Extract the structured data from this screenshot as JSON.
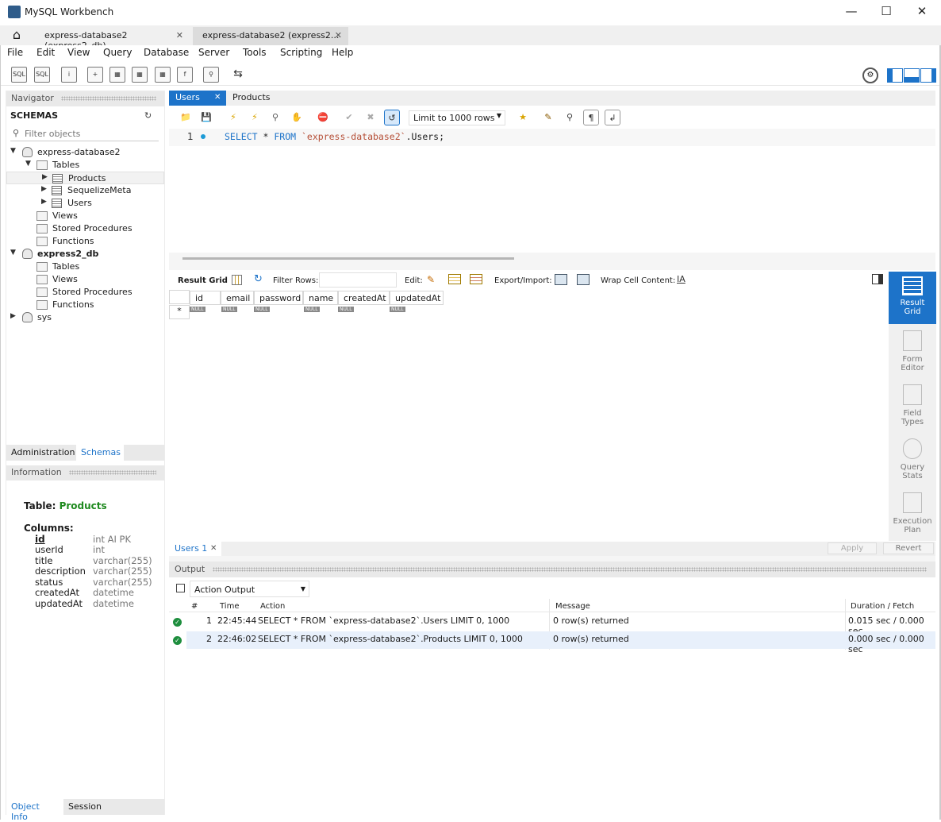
{
  "window": {
    "title": "MySQL Workbench",
    "min": "—",
    "max": "☐",
    "close": "✕"
  },
  "conn_tabs": [
    {
      "label": "express-database2 (express2_db)",
      "close": "✕"
    },
    {
      "label": "express-database2 (express2...",
      "close": "✕"
    }
  ],
  "menu": [
    "File",
    "Edit",
    "View",
    "Query",
    "Database",
    "Server",
    "Tools",
    "Scripting",
    "Help"
  ],
  "navigator": {
    "title": "Navigator",
    "schemas_label": "SCHEMAS",
    "filter_placeholder": "Filter objects",
    "tree": {
      "db1": "express-database2",
      "tables": "Tables",
      "t1": "Products",
      "t2": "SequelizeMeta",
      "t3": "Users",
      "views": "Views",
      "sp": "Stored Procedures",
      "fn": "Functions",
      "db2": "express2_db",
      "tables2": "Tables",
      "views2": "Views",
      "sp2": "Stored Procedures",
      "fn2": "Functions",
      "db3": "sys"
    },
    "tab_admin": "Administration",
    "tab_schemas": "Schemas"
  },
  "info": {
    "title": "Information",
    "table_prefix": "Table:",
    "table_name": "Products",
    "columns_label": "Columns:",
    "columns": [
      {
        "name": "id",
        "type": "int AI PK"
      },
      {
        "name": "userId",
        "type": "int"
      },
      {
        "name": "title",
        "type": "varchar(255)"
      },
      {
        "name": "description",
        "type": "varchar(255)"
      },
      {
        "name": "status",
        "type": "varchar(255)"
      },
      {
        "name": "createdAt",
        "type": "datetime"
      },
      {
        "name": "updatedAt",
        "type": "datetime"
      }
    ],
    "tab_objinfo": "Object Info",
    "tab_session": "Session"
  },
  "query_tabs": [
    {
      "label": "Users",
      "close": "✕"
    },
    {
      "label": "Products"
    }
  ],
  "limit": "Limit to 1000 rows",
  "editor": {
    "line_no": "1",
    "kw1": "SELECT",
    "star": "*",
    "kw2": "FROM",
    "ident": "`express-database2`",
    "rest": ".Users;"
  },
  "result": {
    "grid_label": "Result Grid",
    "filter_label": "Filter Rows:",
    "edit_label": "Edit:",
    "export_label": "Export/Import:",
    "wrap_label": "Wrap Cell Content:",
    "columns": [
      "id",
      "email",
      "password",
      "name",
      "createdAt",
      "updatedAt"
    ],
    "null_text": "NULL",
    "row_marker": "*"
  },
  "side": [
    {
      "label1": "Result",
      "label2": "Grid"
    },
    {
      "label1": "Form",
      "label2": "Editor"
    },
    {
      "label1": "Field",
      "label2": "Types"
    },
    {
      "label1": "Query",
      "label2": "Stats"
    },
    {
      "label1": "Execution",
      "label2": "Plan"
    }
  ],
  "result_tab": {
    "label": "Users 1",
    "close": "✕",
    "apply": "Apply",
    "revert": "Revert"
  },
  "output": {
    "title": "Output",
    "selector": "Action Output",
    "headers": {
      "num": "#",
      "time": "Time",
      "action": "Action",
      "message": "Message",
      "duration": "Duration / Fetch"
    },
    "rows": [
      {
        "num": "1",
        "time": "22:45:44",
        "action": "SELECT * FROM `express-database2`.Users LIMIT 0, 1000",
        "message": "0 row(s) returned",
        "duration": "0.015 sec / 0.000 sec"
      },
      {
        "num": "2",
        "time": "22:46:02",
        "action": "SELECT * FROM `express-database2`.Products LIMIT 0, 1000",
        "message": "0 row(s) returned",
        "duration": "0.000 sec / 0.000 sec"
      }
    ]
  },
  "colors": {
    "accent": "#1d73c9",
    "green": "#1f8a1f",
    "ok": "#1e8e3e"
  }
}
